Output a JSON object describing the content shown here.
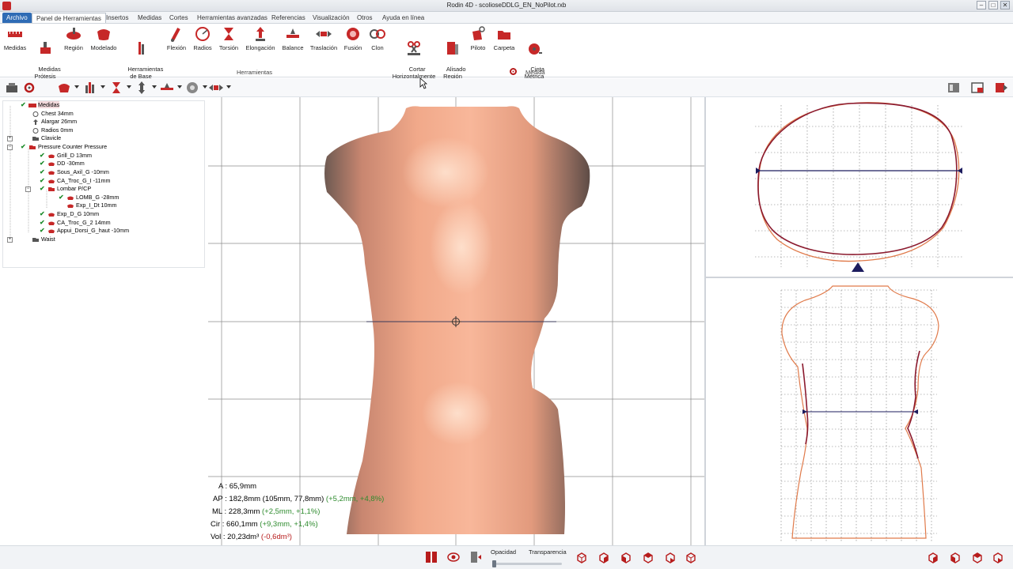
{
  "window": {
    "title": "Rodin 4D - scolioseDDLG_EN_NoPilot.rxb",
    "min": "–",
    "max": "□",
    "close": "✕"
  },
  "menu": {
    "archivo": "Archivo",
    "tabs": [
      "Panel de Herramientas",
      "Insertos",
      "Medidas",
      "Cortes",
      "Herramientas avanzadas",
      "Referencias",
      "Visualización",
      "Otros",
      "Ayuda en línea"
    ]
  },
  "ribbon": {
    "buttons": [
      {
        "id": "medidas",
        "label": "Medidas"
      },
      {
        "id": "medidas-protesis",
        "label": "Medidas\nPrótesis"
      },
      {
        "id": "region",
        "label": "Región"
      },
      {
        "id": "modelado",
        "label": "Modelado"
      },
      {
        "id": "herramientas-base",
        "label": "Herramientas\nde Base"
      },
      {
        "id": "flexion",
        "label": "Flexión"
      },
      {
        "id": "radios",
        "label": "Radios"
      },
      {
        "id": "torsion",
        "label": "Torsión"
      },
      {
        "id": "elongacion",
        "label": "Elongación"
      },
      {
        "id": "balance",
        "label": "Balance"
      },
      {
        "id": "traslacion",
        "label": "Traslación"
      },
      {
        "id": "fusion",
        "label": "Fusión"
      },
      {
        "id": "clon",
        "label": "Clon"
      },
      {
        "id": "cortar",
        "label": "Cortar\nHorizontalmente"
      },
      {
        "id": "alisado",
        "label": "Alisado\nRegión"
      },
      {
        "id": "piloto",
        "label": "Piloto"
      },
      {
        "id": "carpeta",
        "label": "Carpeta"
      },
      {
        "id": "cinta",
        "label": "Cinta\nMétrica"
      }
    ],
    "group_herramientas": "Herramientas",
    "group_medida": "Medida"
  },
  "tree": [
    {
      "label": "Medidas",
      "level": 0,
      "selected": true
    },
    {
      "label": "Chest   34mm",
      "level": 1
    },
    {
      "label": "Alargar   26mm",
      "level": 1
    },
    {
      "label": "Radios   0mm",
      "level": 1
    },
    {
      "label": "Clavicle",
      "level": 1
    },
    {
      "label": "Pressure Counter Pressure",
      "level": 1
    },
    {
      "label": "Grill_D   13mm",
      "level": 2
    },
    {
      "label": "DD   -30mm",
      "level": 2
    },
    {
      "label": "Sous_Axil_G   -10mm",
      "level": 2
    },
    {
      "label": "CA_Troc_G_I   -11mm",
      "level": 2
    },
    {
      "label": "Lombar P/CP",
      "level": 2
    },
    {
      "label": "LOMB_G   -28mm",
      "level": 3
    },
    {
      "label": "Exp_I_Dt   10mm",
      "level": 3
    },
    {
      "label": "Exp_D_G   10mm",
      "level": 2
    },
    {
      "label": "CA_Troc_G_2   14mm",
      "level": 2
    },
    {
      "label": "Appui_Dorsi_G_haut   -10mm",
      "level": 2
    },
    {
      "label": "Waist",
      "level": 1
    }
  ],
  "measurements": {
    "a": "A : 65,9mm",
    "ap": "AP : 182,8mm (105mm, 77,8mm)",
    "ap_delta": "(+5,2mm, +4,8%)",
    "ml": "ML : 228,3mm",
    "ml_delta": "(+2,5mm, +1,1%)",
    "cir": "Cir : 660,1mm",
    "cir_delta": "(+9,3mm, +1,4%)",
    "vol": "Vol : 20,23dm³",
    "vol_delta": "(-0,6dm³)"
  },
  "bottom": {
    "opacidad": "Opacidad",
    "transparencia": "Transparencia",
    "opacity_level": 0.0
  },
  "colors": {
    "accent": "#2f6cb5",
    "skin": "#f0a889",
    "shadow": "#6e5a52",
    "contour_dark": "#8b1a2e",
    "contour_light": "#e08050",
    "section_line": "#1c1c5e"
  }
}
